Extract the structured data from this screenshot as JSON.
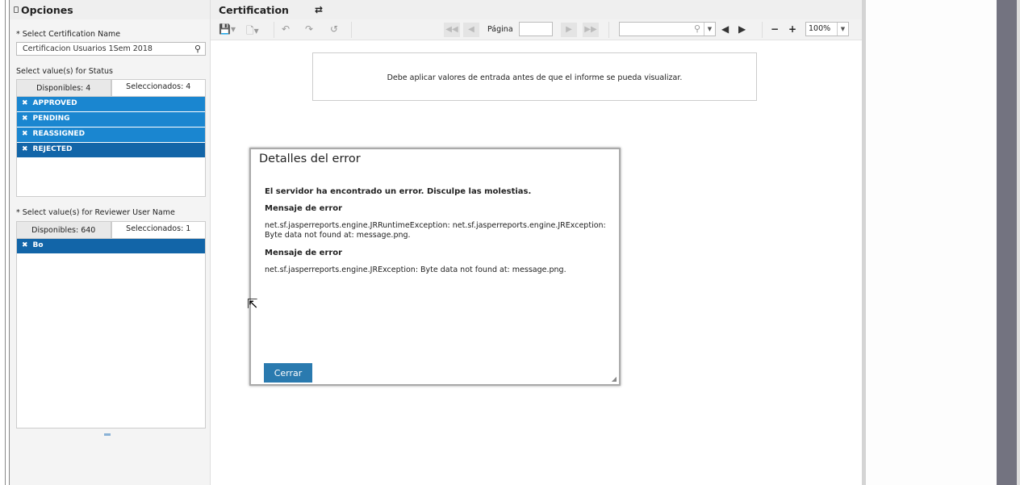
{
  "sidebar": {
    "title": "Opciones",
    "cert_label": "* Select Certification Name",
    "cert_value": "Certificacion Usuarios 1Sem 2018",
    "status_label": "Select value(s) for Status",
    "status_tab_available": "Disponibles: 4",
    "status_tab_selected": "Seleccionados: 4",
    "status_items": [
      "APPROVED",
      "PENDING",
      "REASSIGNED",
      "REJECTED"
    ],
    "reviewer_label": "* Select value(s) for Reviewer User Name",
    "reviewer_tab_available": "Disponibles: 640",
    "reviewer_tab_selected": "Seleccionados: 1",
    "reviewer_items": [
      "Bo"
    ]
  },
  "main": {
    "title": "Certification",
    "page_label": "Página",
    "page_value": "",
    "search_value": "",
    "zoom_value": "100%",
    "notice": "Debe aplicar valores de entrada antes de que el informe se pueda visualizar."
  },
  "dialog": {
    "title": "Detalles del error",
    "headline": "El servidor ha encontrado un error. Disculpe las molestias.",
    "msg_label_1": "Mensaje de error",
    "msg_1": "net.sf.jasperreports.engine.JRRuntimeException: net.sf.jasperreports.engine.JRException: Byte data not found at: message.png.",
    "msg_label_2": "Mensaje de error",
    "msg_2": "net.sf.jasperreports.engine.JRException: Byte data not found at: message.png.",
    "close_label": "Cerrar"
  },
  "colors": {
    "selected_item": "#1a86d0",
    "selected_item_active": "#1265a8",
    "button": "#2a7aaf"
  }
}
